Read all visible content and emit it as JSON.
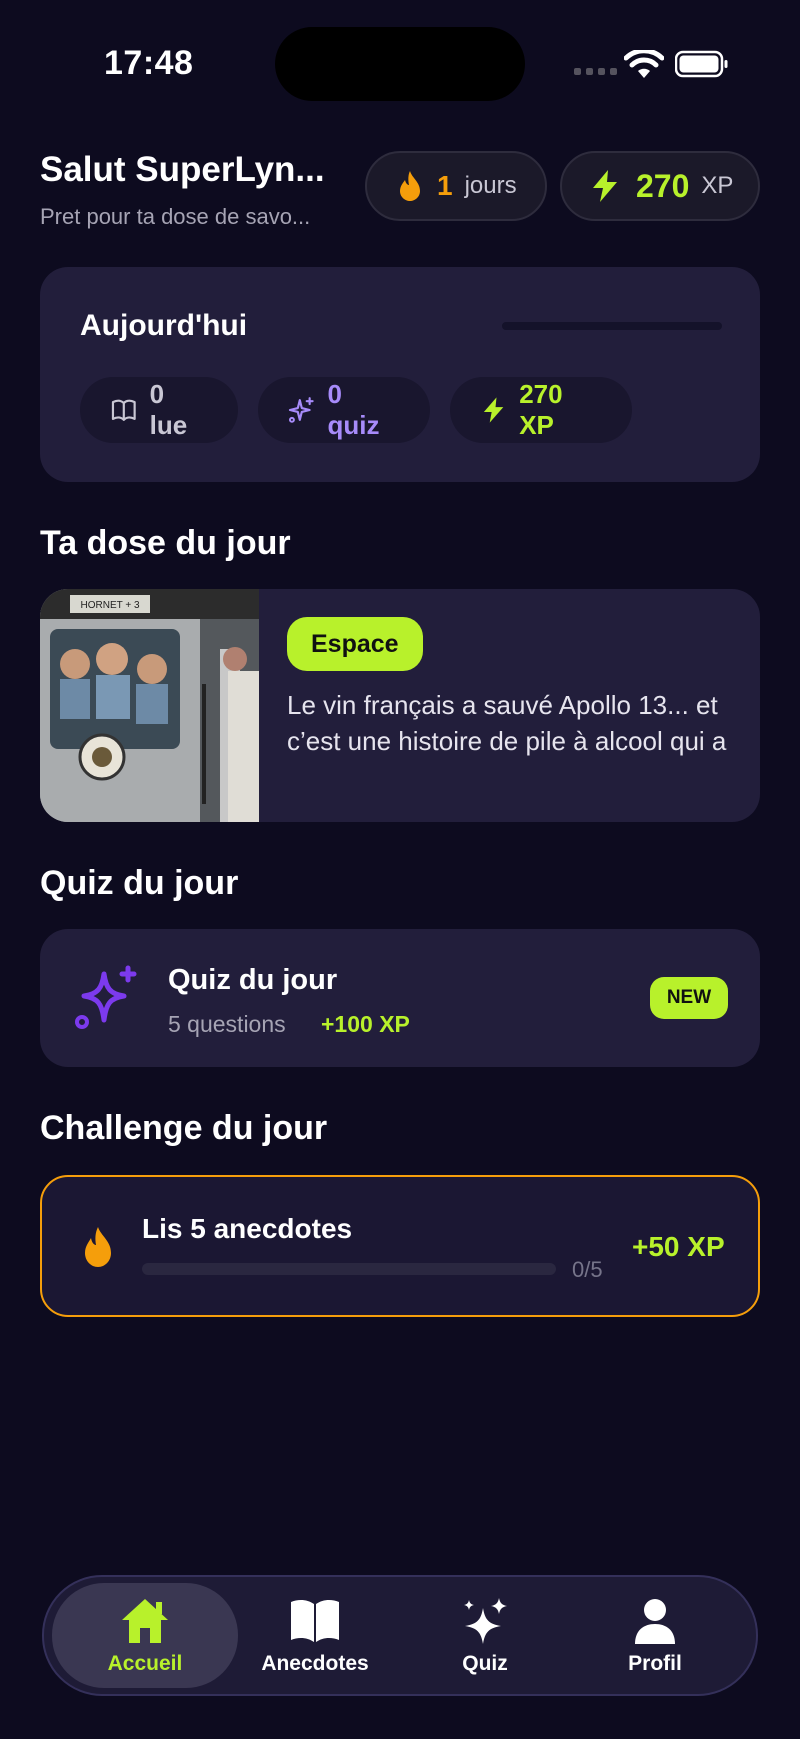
{
  "status_bar": {
    "time": "17:48"
  },
  "header": {
    "greeting": "Salut SuperLyn...",
    "subtitle": "Pret pour ta dose de savo...",
    "streak_value": "1",
    "streak_label": "jours",
    "xp_value": "270",
    "xp_label": "XP"
  },
  "today": {
    "title": "Aujourd'hui",
    "read_label": "0 lue",
    "quiz_label": "0 quiz",
    "xp_label": "270 XP"
  },
  "dose": {
    "section_title": "Ta dose du jour",
    "category": "Espace",
    "text": "Le vin français a sauvé Apollo 13... et c’est une histoire de pile à alcool qui a",
    "image_caption": "HORNET + 3"
  },
  "quiz": {
    "section_title": "Quiz du jour",
    "title": "Quiz du jour",
    "questions": "5 questions",
    "xp": "+100 XP",
    "badge": "NEW"
  },
  "challenge": {
    "section_title": "Challenge du jour",
    "title": "Lis 5 anecdotes",
    "count": "0/5",
    "progress_fraction": 0,
    "xp": "+50 XP"
  },
  "nav": {
    "items": [
      {
        "label": "Accueil",
        "icon": "home-icon",
        "active": true
      },
      {
        "label": "Anecdotes",
        "icon": "book-icon",
        "active": false
      },
      {
        "label": "Quiz",
        "icon": "sparkles-icon",
        "active": false
      },
      {
        "label": "Profil",
        "icon": "user-icon",
        "active": false
      }
    ]
  },
  "colors": {
    "background": "#0d0b1f",
    "card": "#221e3b",
    "accent_green": "#b8f12b",
    "accent_orange": "#f59e0b",
    "accent_purple": "#a78bfa"
  }
}
